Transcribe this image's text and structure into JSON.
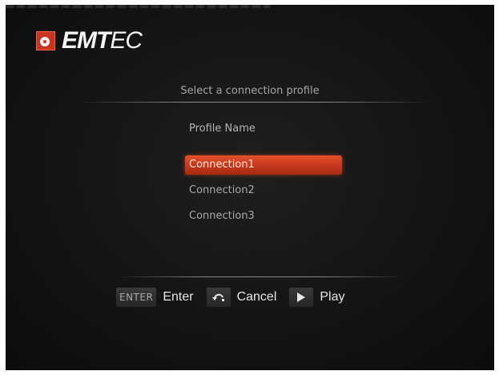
{
  "brand": {
    "name_bold": "EMT",
    "name_light": "EC",
    "logo_icon": "speaker-logo-icon"
  },
  "screen": {
    "heading": "Select a connection profile"
  },
  "profiles": {
    "column_header": "Profile Name",
    "items": [
      {
        "label": "Connection1",
        "selected": true
      },
      {
        "label": "Connection2",
        "selected": false
      },
      {
        "label": "Connection3",
        "selected": false
      }
    ]
  },
  "hints": {
    "enter_key": "ENTER",
    "enter_label": "Enter",
    "cancel_icon": "return-arrow-icon",
    "cancel_label": "Cancel",
    "play_icon": "play-icon",
    "play_label": "Play"
  },
  "colors": {
    "background": "#141414",
    "selection": "#d2401f",
    "text_dim": "#a8a8a8",
    "text_bright": "#e6e6e6"
  }
}
